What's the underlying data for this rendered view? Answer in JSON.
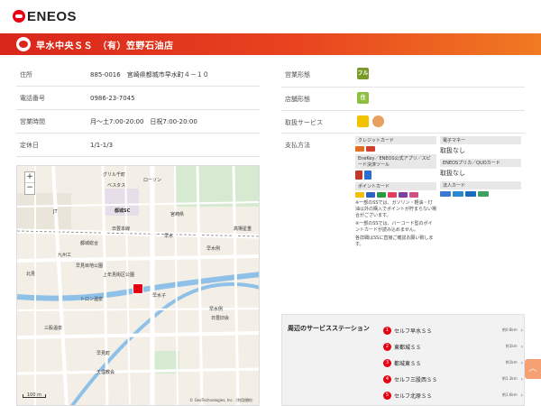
{
  "header": {
    "logo_text": "ENEOS"
  },
  "banner": {
    "title": "早水中央ＳＳ　（有）笠野石油店"
  },
  "info": {
    "rows": [
      {
        "key": "住所",
        "value": "885-0016　宮崎県都城市早水町４－１０"
      },
      {
        "key": "電話番号",
        "value": "0986-23-7045"
      },
      {
        "key": "営業時間",
        "value": "月～土7:00-20:00　日祝7:00-20:00"
      },
      {
        "key": "定休日",
        "value": "1/1-1/3"
      }
    ]
  },
  "map": {
    "zoom_in": "+",
    "zoom_out": "−",
    "labels": {
      "l1": "グリル千町",
      "l2": "ベスタス",
      "l3": "ローソン",
      "l4": "都城SC",
      "l5": "宮崎県",
      "l6": "都城総合",
      "l7": "日豊本線",
      "l8": "早水",
      "l9": "早水例",
      "l10": "高場星重",
      "l11": "九州工",
      "l12": "北見",
      "l13": "早見目地公園",
      "l14": "上年見街区公園",
      "l15": "トロン温泉",
      "l16": "早水例",
      "l17": "日豊旧会",
      "l18": "天理教会",
      "l19": "早見町",
      "l20": "三股温泉",
      "l21": "早水子",
      "l22": "JT"
    },
    "scale": "100 m",
    "copyright": "© GeoTechnologies, Inc.（利用規約）"
  },
  "right": {
    "rows": {
      "format": {
        "key": "営業形態",
        "badge": "フル"
      },
      "shop": {
        "key": "店舗形態",
        "badge": "住"
      },
      "service": {
        "key": "取扱サービス"
      },
      "payment": {
        "key": "支払方法"
      }
    },
    "payment": {
      "credit_head": "クレジットカード",
      "ekey_head": "EneKey／ENEOS公式アプリ／スピード決済ツール",
      "point_head": "ポイントカード",
      "emoney_head": "電子マネー",
      "emoney_text": "取扱なし",
      "prepaid_head": "ENEOSプリカ／QUOカード",
      "prepaid_text": "取扱なし",
      "corp_head": "法人カード",
      "note1": "※一部のSSでは、ガソリン・軽油・灯油以外の購入でポイントが貯まらない場合がございます。",
      "note2": "※一部のSSでは、バーコード型のポイントカードが読み込めません。",
      "note3": "各詳細はSSに直接ご確認お願い致します。"
    }
  },
  "nearby": {
    "title": "周辺のサービスステーション",
    "items": [
      {
        "num": "1",
        "name": "セルフ早水ＳＳ",
        "dist": "約0.8km"
      },
      {
        "num": "2",
        "name": "東都城ＳＳ",
        "dist": "約1km"
      },
      {
        "num": "3",
        "name": "都城東ＳＳ",
        "dist": "約1km"
      },
      {
        "num": "4",
        "name": "セルフ三股西ＳＳ",
        "dist": "約1.3km"
      },
      {
        "num": "5",
        "name": "セルフ北原ＳＳ",
        "dist": "約1.6km"
      }
    ]
  },
  "totop": {
    "label": "︿"
  }
}
